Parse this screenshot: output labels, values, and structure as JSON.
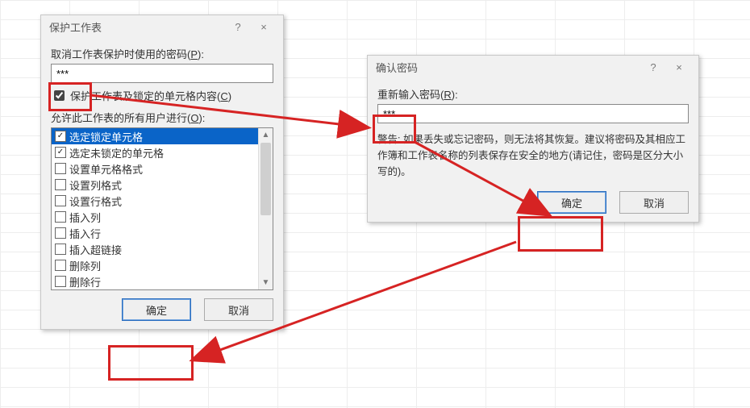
{
  "dialog1": {
    "title": "保护工作表",
    "help": "?",
    "close": "×",
    "pw_label_pre": "取消工作表保护时使用的密码(",
    "pw_label_u": "P",
    "pw_label_post": "):",
    "pw_value": "***",
    "protect_cb_pre": "保护工作表及锁定的单元格内容(",
    "protect_cb_u": "C",
    "protect_cb_post": ")",
    "allow_label_pre": "允许此工作表的所有用户进行(",
    "allow_label_u": "O",
    "allow_label_post": "):",
    "items": [
      {
        "label": "选定锁定单元格",
        "checked": true,
        "selected": true
      },
      {
        "label": "选定未锁定的单元格",
        "checked": true
      },
      {
        "label": "设置单元格格式",
        "checked": false
      },
      {
        "label": "设置列格式",
        "checked": false
      },
      {
        "label": "设置行格式",
        "checked": false
      },
      {
        "label": "插入列",
        "checked": false
      },
      {
        "label": "插入行",
        "checked": false
      },
      {
        "label": "插入超链接",
        "checked": false
      },
      {
        "label": "删除列",
        "checked": false
      },
      {
        "label": "删除行",
        "checked": false
      }
    ],
    "ok": "确定",
    "cancel": "取消"
  },
  "dialog2": {
    "title": "确认密码",
    "help": "?",
    "close": "×",
    "pw_label_pre": "重新输入密码(",
    "pw_label_u": "R",
    "pw_label_post": "):",
    "pw_value": "***",
    "warn": "警告: 如果丢失或忘记密码，则无法将其恢复。建议将密码及其相应工作簿和工作表名称的列表保存在安全的地方(请记住，密码是区分大小写的)。",
    "ok": "确定",
    "cancel": "取消"
  },
  "colors": {
    "red": "#d62323"
  }
}
